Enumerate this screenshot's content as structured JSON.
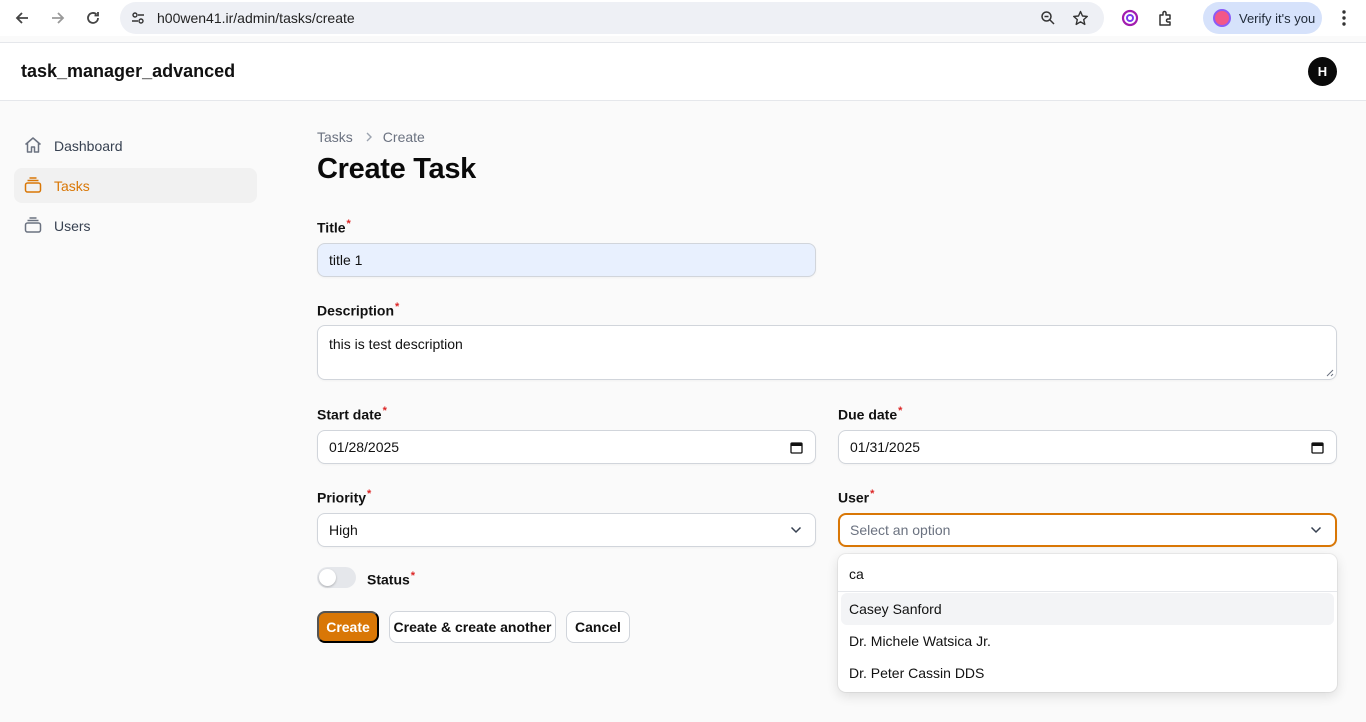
{
  "browser": {
    "url": "h00wen41.ir/admin/tasks/create",
    "verify_label": "Verify it's you"
  },
  "app": {
    "brand": "task_manager_advanced",
    "avatar_initial": "H"
  },
  "sidebar": {
    "items": [
      {
        "label": "Dashboard",
        "icon": "home-icon",
        "active": false
      },
      {
        "label": "Tasks",
        "icon": "stack-icon",
        "active": true
      },
      {
        "label": "Users",
        "icon": "stack-icon",
        "active": false
      }
    ]
  },
  "breadcrumb": {
    "items": [
      "Tasks",
      "Create"
    ]
  },
  "page": {
    "title": "Create Task"
  },
  "form": {
    "title": {
      "label": "Title",
      "value": "title 1"
    },
    "description": {
      "label": "Description",
      "value": "this is test description"
    },
    "start_date": {
      "label": "Start date",
      "value": "01/28/2025"
    },
    "due_date": {
      "label": "Due date",
      "value": "01/31/2025"
    },
    "priority": {
      "label": "Priority",
      "value": "High"
    },
    "user": {
      "label": "User",
      "placeholder": "Select an option",
      "search": "ca",
      "options": [
        "Casey Sanford",
        "Dr. Michele Watsica Jr.",
        "Dr. Peter Cassin DDS"
      ]
    },
    "status": {
      "label": "Status",
      "checked": false
    },
    "required_mark": "*"
  },
  "actions": {
    "create": "Create",
    "create_another": "Create & create another",
    "cancel": "Cancel"
  },
  "colors": {
    "accent": "#d97706",
    "required": "#dc2626"
  }
}
